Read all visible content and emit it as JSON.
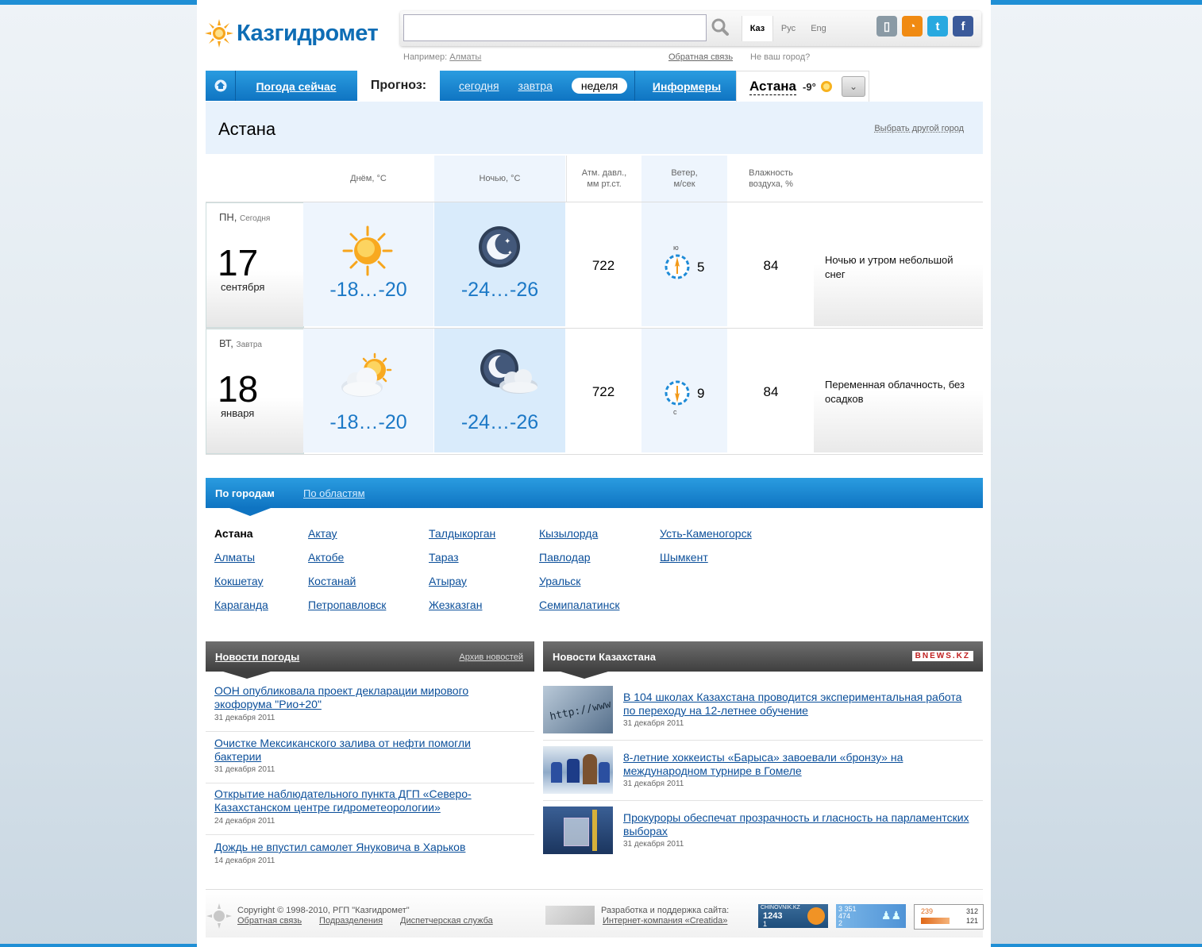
{
  "header": {
    "logo": "Казгидромет",
    "search_placeholder": "",
    "langs": [
      "Каз",
      "Рус",
      "Eng"
    ],
    "hint_prefix": "Например:",
    "hint_city": "Алматы",
    "feedback": "Обратная связь",
    "not_your_city": "Не ваш город?",
    "social_icons": [
      "mobile-icon",
      "rss-icon",
      "twitter-icon",
      "facebook-icon"
    ]
  },
  "nav": {
    "now": "Погода сейчас",
    "forecast": "Прогноз:",
    "today": "сегодня",
    "tomorrow": "завтра",
    "week": "неделя",
    "informers": "Информеры",
    "city": "Астана",
    "city_temp": "-9°"
  },
  "city_panel": {
    "title": "Астана",
    "other": "Выбрать другой город"
  },
  "table_header": {
    "day": "Днём, °С",
    "night": "Ночью, °С",
    "pressure_1": "Атм. давл.,",
    "pressure_2": "мм рт.ст.",
    "wind_1": "Ветер,",
    "wind_2": "м/сек",
    "humidity_1": "Влажность",
    "humidity_2": "воздуха, %"
  },
  "forecast": [
    {
      "weekday": "ПН,",
      "rel": "Сегодня",
      "day": "17",
      "month": "сентября",
      "day_icon": "sun-icon",
      "night_icon": "moon-icon",
      "day_temp": "-18…-20",
      "night_temp": "-24…-26",
      "pressure": "722",
      "wind_dir": "ю",
      "wind": "5",
      "humidity": "84",
      "desc": "Ночью и утром небольшой снег"
    },
    {
      "weekday": "ВТ,",
      "rel": "Завтра",
      "day": "18",
      "month": "января",
      "day_icon": "sun-cloud-icon",
      "night_icon": "moon-cloud-icon",
      "day_temp": "-18…-20",
      "night_temp": "-24…-26",
      "pressure": "722",
      "wind_dir": "с",
      "wind": "9",
      "humidity": "84",
      "desc": "Переменная облачность, без осадков"
    }
  ],
  "cities": {
    "tab_cities": "По городам",
    "tab_regions": "По областям",
    "col1": [
      "Астана",
      "Алматы",
      "Кокшетау",
      "Караганда"
    ],
    "col2": [
      "Актау",
      "Актобе",
      "Костанай",
      "Петропавловск"
    ],
    "col3": [
      "Талдыкорган",
      "Тараз",
      "Атырау",
      "Жезказган"
    ],
    "col4": [
      "Кызылорда",
      "Павлодар",
      "Уральск",
      "Семипалатинск"
    ],
    "col5": [
      "Усть-Каменогорск",
      "Шымкент"
    ]
  },
  "weather_news": {
    "title": "Новости погоды",
    "archive": "Архив новостей",
    "items": [
      {
        "title": "ООН опубликовала проект декларации мирового экофорума \"Рио+20\"",
        "date": "31 декабря 2011"
      },
      {
        "title": "Очистке Мексиканского залива от нефти помогли бактерии",
        "date": "31 декабря 2011"
      },
      {
        "title": "Открытие наблюдательного пункта ДГП «Северо-Казахстанском центре гидрометеорологии»",
        "date": "24 декабря 2011"
      },
      {
        "title": "Дождь не впустил самолет Януковича в Харьков",
        "date": "14 декабря 2011"
      }
    ]
  },
  "kz_news": {
    "title": "Новости Казахстана",
    "badge": "BNEWS.KZ",
    "items": [
      {
        "title": "В 104 школах Казахстана проводится экспериментальная работа по переходу на 12-летнее обучение",
        "date": "31 декабря 2011",
        "thumb": "http://www"
      },
      {
        "title": "8-летние хоккеисты «Барыса» завоевали «бронзу» на международном турнире в Гомеле",
        "date": "31 декабря 2011",
        "thumb": ""
      },
      {
        "title": "Прокуроры обеспечат прозрачность и гласность на парламентских выборах",
        "date": "31 декабря 2011",
        "thumb": ""
      }
    ]
  },
  "footer": {
    "copyright": "Copyright © 1998-2010, РГП \"Казгидромет\"",
    "links": [
      "Обратная связь",
      "Подразделения",
      "Диспетчерская служба"
    ],
    "dev_label": "Разработка и поддержка сайта:",
    "dev_link": "Интернет-компания «Creatida»",
    "counter1_label": "CHINOVNIK.KZ",
    "counter1_a": "1243",
    "counter1_b": "1",
    "counter2_a": "3 351",
    "counter2_b": "474",
    "counter2_c": "2",
    "counter3_a": "239",
    "counter3_b": "312",
    "counter3_c": "121"
  }
}
